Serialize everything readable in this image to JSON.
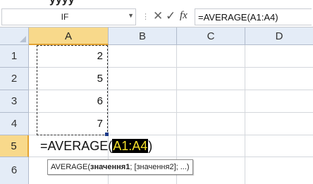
{
  "formula_bar": {
    "name_box": "IF",
    "formula": "=AVERAGE(A1:A4)"
  },
  "grid": {
    "columns": [
      "A",
      "B",
      "C",
      "D"
    ],
    "rows": [
      "1",
      "2",
      "3",
      "4",
      "5",
      "6"
    ],
    "values": {
      "A1": "2",
      "A2": "5",
      "A3": "6",
      "A4": "7"
    },
    "editing": {
      "prefix": "=AVERAGE(",
      "reference": "A1:A4",
      "suffix": ")"
    },
    "tooltip": {
      "func": "AVERAGE(",
      "arg1": "значення1",
      "rest": "; [значення2]; ...)"
    }
  },
  "icons": {
    "name_box_dropdown": "chevron-down-icon",
    "cancel": "close-icon",
    "enter": "check-icon",
    "insert_function": "fx-icon"
  },
  "colors": {
    "header_bg": "#e4ecf7",
    "active_header_bg": "#f8d98b",
    "reference_highlight_bg": "#000000",
    "reference_highlight_text": "#f5e12b"
  }
}
